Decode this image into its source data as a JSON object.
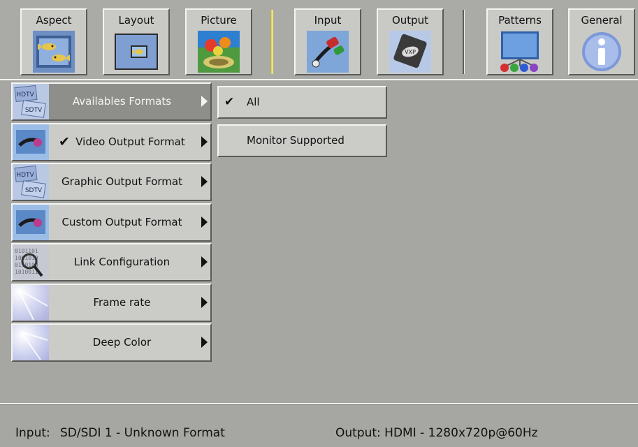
{
  "toolbar": {
    "buttons": [
      {
        "label": "Aspect",
        "icon": "aspect-fish-icon"
      },
      {
        "label": "Layout",
        "icon": "layout-fish-icon"
      },
      {
        "label": "Picture",
        "icon": "picture-flower-icon"
      },
      {
        "label": "Input",
        "icon": "input-cable-icon"
      },
      {
        "label": "Output",
        "icon": "output-vxp-icon"
      },
      {
        "label": "Patterns",
        "icon": "patterns-screen-icon"
      },
      {
        "label": "General",
        "icon": "general-info-icon"
      }
    ]
  },
  "menu": {
    "items": [
      {
        "label": "Availables Formats",
        "icon": "hdtv-sdtv-icon",
        "active": true,
        "checked": false
      },
      {
        "label": "Video Output Format",
        "icon": "video-output-icon",
        "active": false,
        "checked": true
      },
      {
        "label": "Graphic Output Format",
        "icon": "hdtv-sdtv-icon",
        "active": false,
        "checked": false
      },
      {
        "label": "Custom Output Format",
        "icon": "video-output-icon",
        "active": false,
        "checked": false
      },
      {
        "label": "Link Configuration",
        "icon": "binary-magnifier-icon",
        "active": false,
        "checked": false
      },
      {
        "label": "Frame rate",
        "icon": "light-rays-icon",
        "active": false,
        "checked": false
      },
      {
        "label": "Deep Color",
        "icon": "light-rays-icon",
        "active": false,
        "checked": false
      }
    ],
    "check_glyph": "✔"
  },
  "submenu": {
    "items": [
      {
        "label": "All",
        "checked": true
      },
      {
        "label": "Monitor Supported",
        "checked": false
      }
    ],
    "check_glyph": "✔"
  },
  "status": {
    "input_label": "Input:",
    "input_value": "SD/SDI 1 - Unknown Format",
    "output_text": "Output: HDMI - 1280x720p@60Hz"
  },
  "colors": {
    "background": "#a6a6a2",
    "button_face": "#cbcbc8",
    "active_item": "#8e8e8b",
    "separator_accent": "#e7d83a"
  }
}
